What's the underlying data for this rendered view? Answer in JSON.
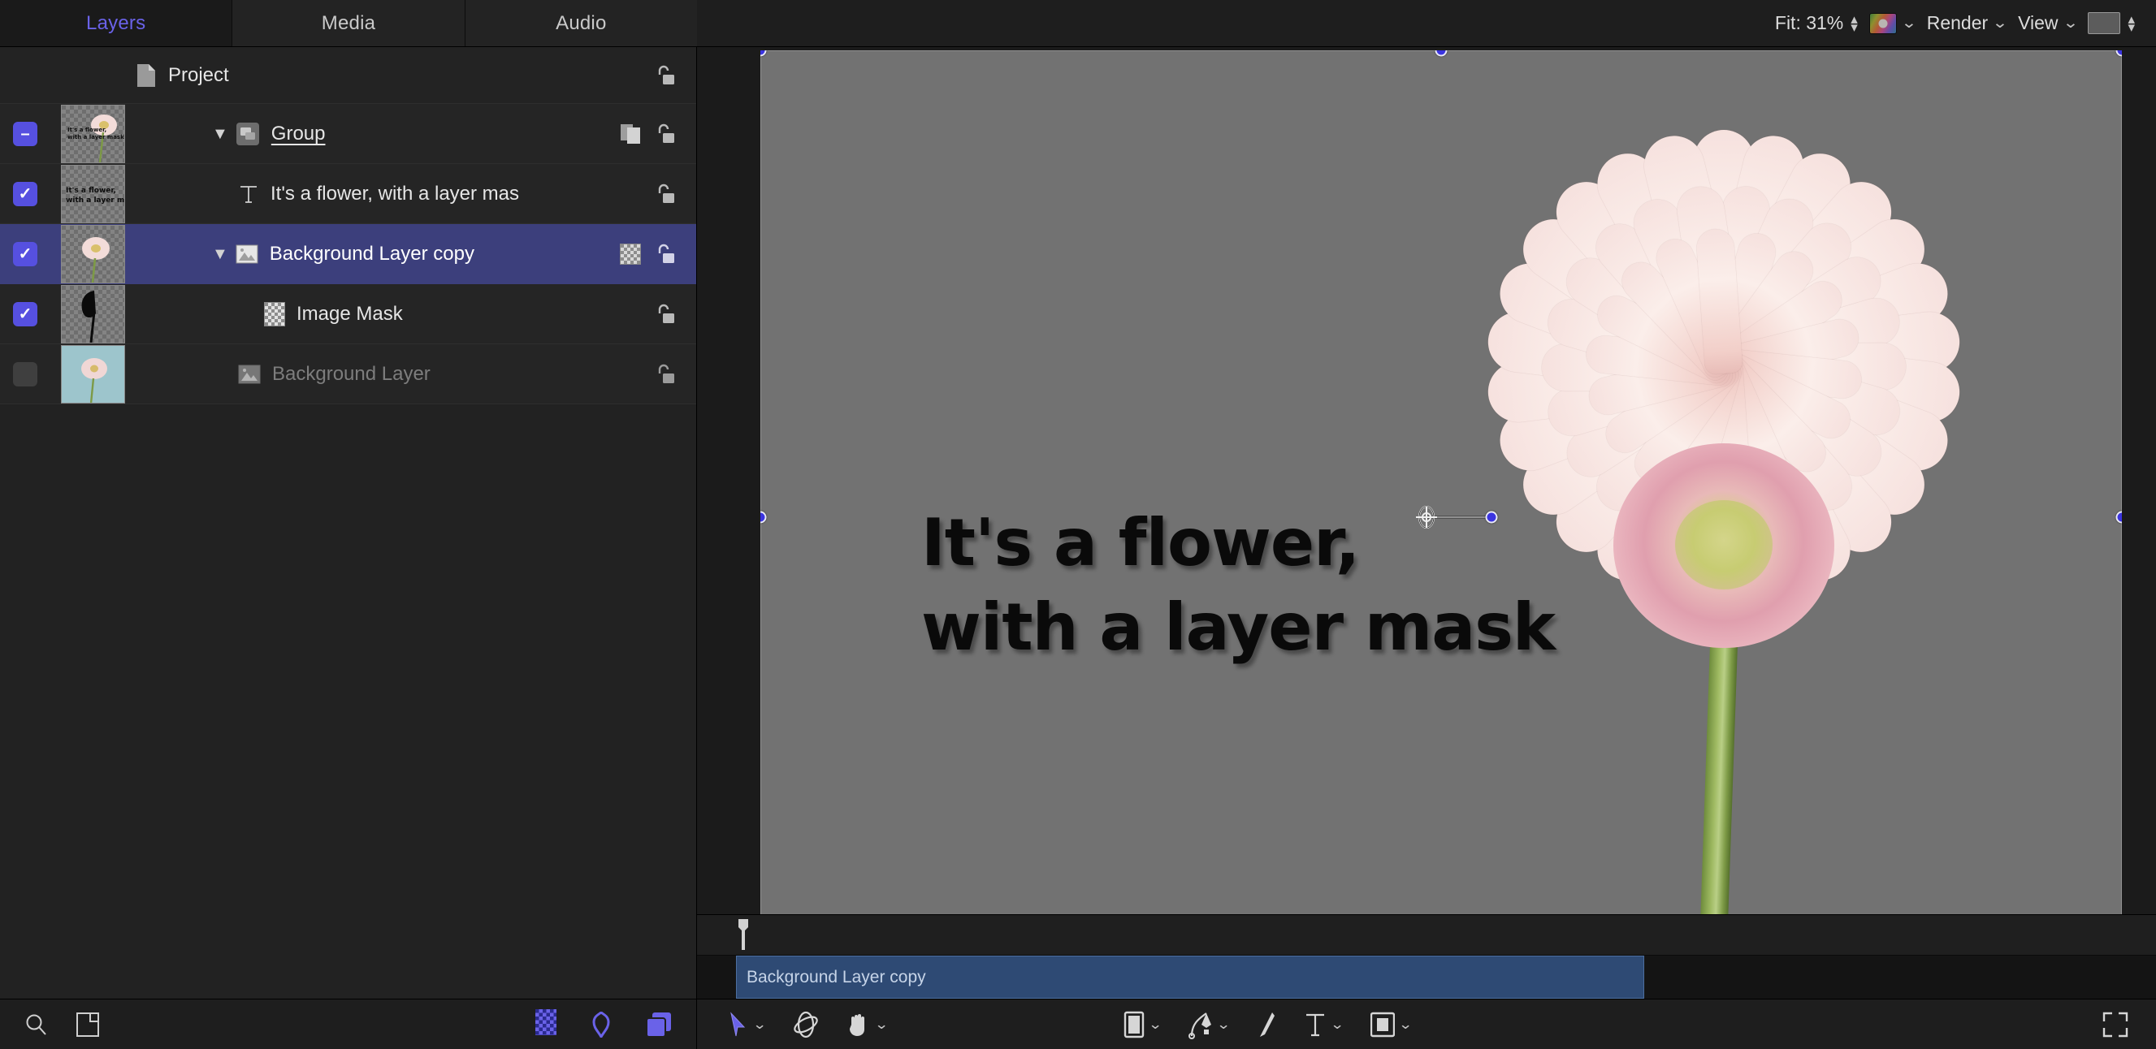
{
  "sidebar": {
    "tabs": [
      {
        "label": "Layers",
        "active": true
      },
      {
        "label": "Media",
        "active": false
      },
      {
        "label": "Audio",
        "active": false
      }
    ],
    "rows": [
      {
        "name": "Project",
        "icon": "document-icon",
        "checkbox": "none",
        "lock": "unlocked-icon",
        "has_thumb": false,
        "disclosure": "",
        "selected": false,
        "dim": false,
        "underline": false,
        "badges": []
      },
      {
        "name": "Group",
        "icon": "group-icon",
        "checkbox": "mixed",
        "lock": "unlocked-icon",
        "has_thumb": true,
        "disclosure": "▼",
        "selected": false,
        "dim": false,
        "underline": true,
        "badges": [
          "group-badge"
        ]
      },
      {
        "name": "It's a flower, with a layer mas",
        "icon": "text-layer-icon",
        "checkbox": "on",
        "lock": "unlocked-icon",
        "has_thumb": true,
        "disclosure": "",
        "selected": false,
        "dim": false,
        "underline": false,
        "badges": []
      },
      {
        "name": "Background Layer copy",
        "icon": "image-layer-icon",
        "checkbox": "on",
        "lock": "unlocked-icon",
        "has_thumb": true,
        "disclosure": "▼",
        "selected": true,
        "dim": false,
        "underline": false,
        "badges": [
          "mask-badge"
        ]
      },
      {
        "name": "Image Mask",
        "icon": "checkerboard-mask-icon",
        "checkbox": "on",
        "lock": "unlocked-icon",
        "has_thumb": true,
        "disclosure": "",
        "selected": false,
        "dim": false,
        "underline": false,
        "badges": []
      },
      {
        "name": "Background Layer",
        "icon": "image-layer-icon",
        "checkbox": "off",
        "lock": "unlocked-icon",
        "has_thumb": true,
        "disclosure": "",
        "selected": false,
        "dim": true,
        "underline": false,
        "badges": []
      }
    ],
    "bottom_bar": {
      "search": "search-icon",
      "layout": "panel-layout-icon",
      "mask_tool": "checkerboard-icon",
      "behavior_tool": "gear-burst-icon",
      "group_tool": "new-group-icon"
    }
  },
  "canvas_toolbar": {
    "fit_label": "Fit: 31%",
    "color_swatch": "rainbow-swatch",
    "render_label": "Render",
    "view_label": "View",
    "background_swatch": "gray-swatch"
  },
  "canvas": {
    "text_line_1": "It's a flower,",
    "text_line_2": "with a layer mask",
    "background_color": "#727272"
  },
  "timeline": {
    "clip_label": "Background Layer copy"
  },
  "bottom_toolbar": {
    "left_tools": [
      {
        "name": "select-tool",
        "icon": "arrow-cursor-icon",
        "has_menu": true,
        "active": true
      },
      {
        "name": "transform-3d-tool",
        "icon": "orbit-icon",
        "has_menu": false,
        "active": false
      },
      {
        "name": "pan-tool",
        "icon": "hand-icon",
        "has_menu": true,
        "active": false
      }
    ],
    "mid_tools": [
      {
        "name": "shape-tool",
        "icon": "rectangle-icon",
        "has_menu": true,
        "active": false
      },
      {
        "name": "bezier-tool",
        "icon": "pen-icon",
        "has_menu": true,
        "active": false
      },
      {
        "name": "paint-tool",
        "icon": "brush-icon",
        "has_menu": false,
        "active": false
      },
      {
        "name": "text-tool",
        "icon": "text-t-icon",
        "has_menu": true,
        "active": false
      },
      {
        "name": "mask-tool",
        "icon": "mask-rect-icon",
        "has_menu": true,
        "active": false
      }
    ],
    "right_tool": {
      "name": "fullscreen-toggle",
      "icon": "expand-arrows-icon"
    }
  },
  "colors": {
    "accent": "#5650e0",
    "selection_row": "#3c3f7c",
    "tab_active_text": "#6a62e8",
    "canvas_bg": "#727272",
    "timeline_clip": "#2e4a74"
  }
}
